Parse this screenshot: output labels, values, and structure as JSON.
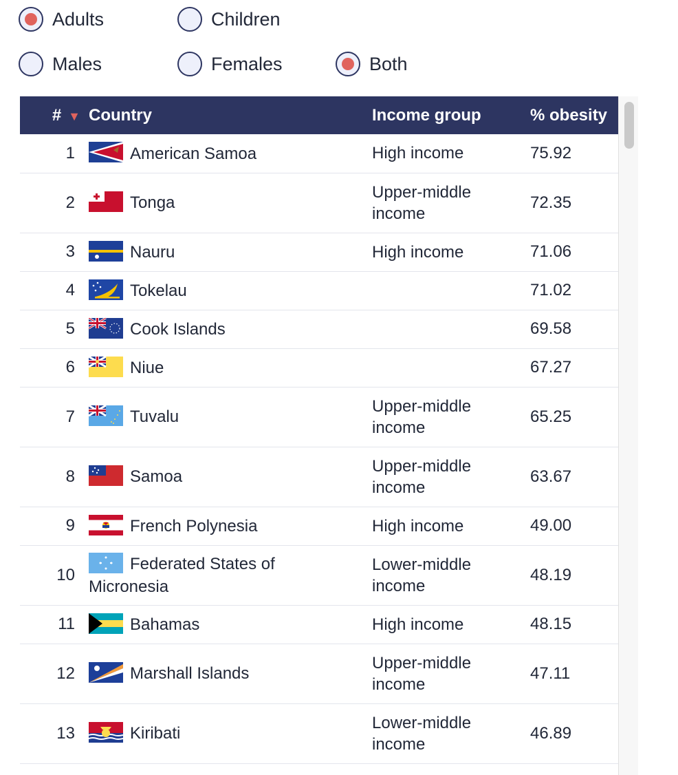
{
  "radios": {
    "age": [
      {
        "label": "Adults",
        "checked": true
      },
      {
        "label": "Children",
        "checked": false
      }
    ],
    "sex": [
      {
        "label": "Males",
        "checked": false
      },
      {
        "label": "Females",
        "checked": false
      },
      {
        "label": "Both",
        "checked": true
      }
    ]
  },
  "table": {
    "headers": {
      "rank": "#",
      "country": "Country",
      "income": "Income group",
      "obesity": "% obesity"
    },
    "sort_icon": "triangle-down-icon",
    "sort_color": "#e0635d",
    "header_bg": "#2d3561",
    "rows": [
      {
        "rank": "1",
        "country": "American Samoa",
        "income": "High income",
        "obesity": "75.92",
        "flag": "american-samoa-flag-icon"
      },
      {
        "rank": "2",
        "country": "Tonga",
        "income": "Upper-middle income",
        "obesity": "72.35",
        "flag": "tonga-flag-icon"
      },
      {
        "rank": "3",
        "country": "Nauru",
        "income": "High income",
        "obesity": "71.06",
        "flag": "nauru-flag-icon"
      },
      {
        "rank": "4",
        "country": "Tokelau",
        "income": "",
        "obesity": "71.02",
        "flag": "tokelau-flag-icon"
      },
      {
        "rank": "5",
        "country": "Cook Islands",
        "income": "",
        "obesity": "69.58",
        "flag": "cook-islands-flag-icon"
      },
      {
        "rank": "6",
        "country": "Niue",
        "income": "",
        "obesity": "67.27",
        "flag": "niue-flag-icon"
      },
      {
        "rank": "7",
        "country": "Tuvalu",
        "income": "Upper-middle income",
        "obesity": "65.25",
        "flag": "tuvalu-flag-icon"
      },
      {
        "rank": "8",
        "country": "Samoa",
        "income": "Upper-middle income",
        "obesity": "63.67",
        "flag": "samoa-flag-icon"
      },
      {
        "rank": "9",
        "country": "French Polynesia",
        "income": "High income",
        "obesity": "49.00",
        "flag": "french-polynesia-flag-icon"
      },
      {
        "rank": "10",
        "country": "Federated States of Micronesia",
        "income": "Lower-middle income",
        "obesity": "48.19",
        "flag": "micronesia-flag-icon"
      },
      {
        "rank": "11",
        "country": "Bahamas",
        "income": "High income",
        "obesity": "48.15",
        "flag": "bahamas-flag-icon"
      },
      {
        "rank": "12",
        "country": "Marshall Islands",
        "income": "Upper-middle income",
        "obesity": "47.11",
        "flag": "marshall-islands-flag-icon"
      },
      {
        "rank": "13",
        "country": "Kiribati",
        "income": "Lower-middle income",
        "obesity": "46.89",
        "flag": "kiribati-flag-icon"
      }
    ]
  }
}
